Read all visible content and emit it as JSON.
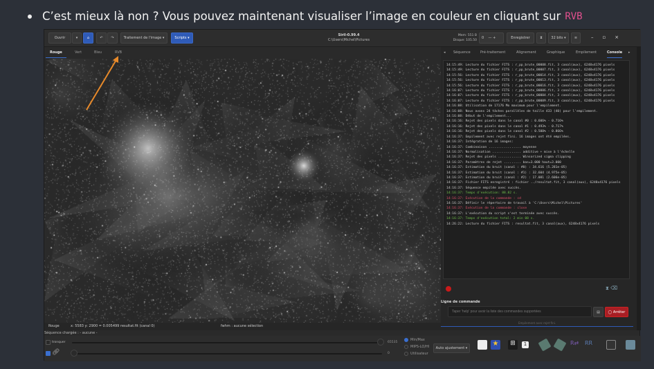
{
  "post": {
    "text": "C’est mieux là non ? Vous pouvez maintenant visualiser l’image en couleur en cliquant sur",
    "highlight": "RVB",
    "highlight_color": "#e4508f"
  },
  "app": {
    "title": "Siril-0.99.4",
    "path": "C:\\Users\\Michel\\Pictures",
    "toolbar": {
      "open": "Ouvrir",
      "processing": "Traitement de l'image ▾",
      "scripts": "Scripts ▾",
      "mem": "Mem: 551 B",
      "disk": "Disque: 105.50",
      "spin": "0",
      "save": "Enregistrer",
      "bits": "32 bits ▾"
    },
    "channel_tabs": [
      "Rouge",
      "Vert",
      "Bleu",
      "RVB"
    ],
    "active_channel": "Rouge",
    "panel_tabs": [
      "Séquence",
      "Pré-traitement",
      "Alignement",
      "Graphique",
      "Empilement",
      "Console"
    ],
    "active_panel": "Console",
    "console": [
      {
        "t": "14:15:49: Lecture du fichier FITS : r_pp_brute_00008.fit, 3 canal(aux), 6248x4176 pixels",
        "c": ""
      },
      {
        "t": "14:15:49: Lecture du fichier FITS : r_pp_brute_00007.fit, 3 canal(aux), 6248x4176 pixels",
        "c": ""
      },
      {
        "t": "14:15:56: Lecture du fichier FITS : r_pp_brute_00014.fit, 3 canal(aux), 6248x4176 pixels",
        "c": ""
      },
      {
        "t": "14:15:56: Lecture du fichier FITS : r_pp_brute_00013.fit, 3 canal(aux), 6248x4176 pixels",
        "c": ""
      },
      {
        "t": "14:15:56: Lecture du fichier FITS : r_pp_brute_00016.fit, 3 canal(aux), 6248x4176 pixels",
        "c": ""
      },
      {
        "t": "14:16:07: Lecture du fichier FITS : r_pp_brute_00006.fit, 3 canal(aux), 6248x4176 pixels",
        "c": ""
      },
      {
        "t": "14:16:07: Lecture du fichier FITS : r_pp_brute_00004.fit, 3 canal(aux), 6248x4176 pixels",
        "c": ""
      },
      {
        "t": "14:16:07: Lecture du fichier FITS : r_pp_brute_00009.fit, 3 canal(aux), 6248x4176 pixels",
        "c": ""
      },
      {
        "t": "14:16:08: Utilisation de 17176 Mo maximum pour l'empilement.",
        "c": ""
      },
      {
        "t": "14:16:08: Nous avons 24 tâches parallèles de taille 433 (40) pour l'empilement.",
        "c": ""
      },
      {
        "t": "14:16:08: Début de l'empilement...",
        "c": ""
      },
      {
        "t": "14:16:16: Rejet des pixels dans le canal #0 : 0.606% - 0.716%",
        "c": ""
      },
      {
        "t": "14:16:16: Rejet des pixels dans le canal #1 : 0.493% - 0.717%",
        "c": ""
      },
      {
        "t": "14:16:16: Rejet des pixels dans le canal #2 : 0.500% - 0.866%",
        "c": ""
      },
      {
        "t": "14:16:37: Empilement avec rejet fini. 16 images ont été empilées.",
        "c": ""
      },
      {
        "t": "14:16:37: Intégration de 16 images:",
        "c": ""
      },
      {
        "t": "14:16:37: Combinaison ................. moyenne",
        "c": ""
      },
      {
        "t": "14:16:37: Normalisation ............... additive + mise à l'échelle",
        "c": ""
      },
      {
        "t": "14:16:37: Rejet des pixels ............ Winsorized sigma clipping",
        "c": ""
      },
      {
        "t": "14:16:37: Paramètres de rejet ......... bas=3.000 haut=3.000",
        "c": ""
      },
      {
        "t": "14:16:37: Estimation du bruit (canal : #0) : 34.616 (5.281e-05)",
        "c": ""
      },
      {
        "t": "14:16:37: Estimation du bruit (canal : #1) : 32.604 (4.975e-05)",
        "c": ""
      },
      {
        "t": "14:16:37: Estimation du bruit (canal : #2) : 17.081 (2.606e-05)",
        "c": ""
      },
      {
        "t": "14:16:37: Fichier FITS enregistré : fichier ../resultat.fit, 3 canal(aux), 6248x4176 pixels",
        "c": ""
      },
      {
        "t": "14:16:37: Séquence empilée avec succès.",
        "c": ""
      },
      {
        "t": "14:16:37: Temps d'exécution: 88.82 s.",
        "c": "g"
      },
      {
        "t": "14:16:37: Exécution de la commande : cd",
        "c": "r"
      },
      {
        "t": "14:16:37: Définir le répertoire de travail à 'C:\\Users\\Michel\\Pictures'",
        "c": ""
      },
      {
        "t": "14:16:37: Exécution de la commande : close",
        "c": "r"
      },
      {
        "t": "14:16:37: L'exécution du script s'est terminée avec succès.",
        "c": ""
      },
      {
        "t": "14:16:37: Temps d'exécution total: 2 min 08 s.",
        "c": "g"
      },
      {
        "t": "14:26:22: Lecture du fichier FITS : resultat.fit, 3 canal(aux), 6248x4176 pixels",
        "c": ""
      }
    ],
    "command": {
      "label": "Ligne de commande",
      "placeholder": "Taper 'help' pour avoir la liste des commandes supportées",
      "stop": "Arrêter",
      "progress": "Empilement avec rejet fini."
    },
    "status": {
      "channel": "Rouge",
      "coords": "x: 5583 y: 2900 = 0.005499",
      "file": "resultat.fit (canal 0)",
      "fwhm": "fwhm : aucune sélection"
    },
    "sequence": "Séquence chargée : - aucune -",
    "bottom": {
      "clip": "tronquer",
      "max": "65535",
      "min": "0",
      "modes": [
        "Min/Max",
        "MIPS-LO/HI",
        "Utilisateur"
      ],
      "selected_mode": "Min/Max",
      "autofit": "Auto ajustement ▾"
    }
  }
}
